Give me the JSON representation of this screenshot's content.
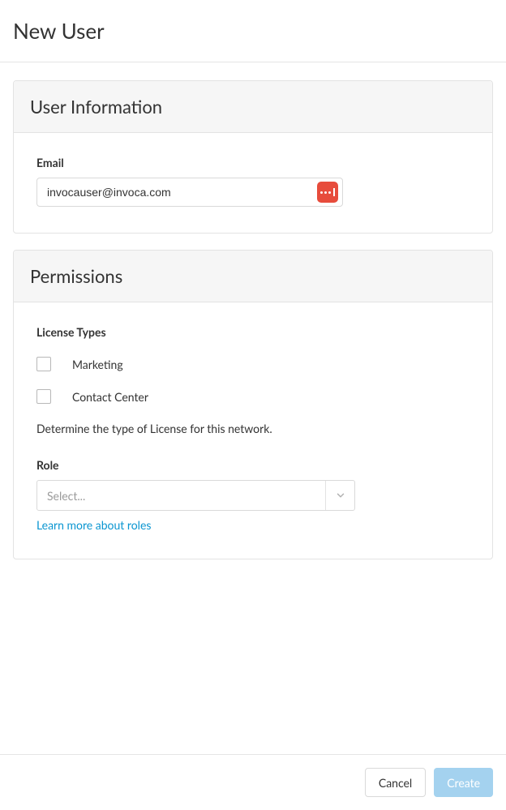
{
  "page": {
    "title": "New User"
  },
  "userInfo": {
    "panelTitle": "User Information",
    "emailLabel": "Email",
    "emailValue": "invocauser@invoca.com"
  },
  "permissions": {
    "panelTitle": "Permissions",
    "licenseTypesLabel": "License Types",
    "options": [
      {
        "label": "Marketing",
        "checked": false
      },
      {
        "label": "Contact Center",
        "checked": false
      }
    ],
    "helpText": "Determine the type of License for this network.",
    "roleLabel": "Role",
    "rolePlaceholder": "Select...",
    "learnMoreLink": "Learn more about roles"
  },
  "footer": {
    "cancel": "Cancel",
    "create": "Create"
  }
}
